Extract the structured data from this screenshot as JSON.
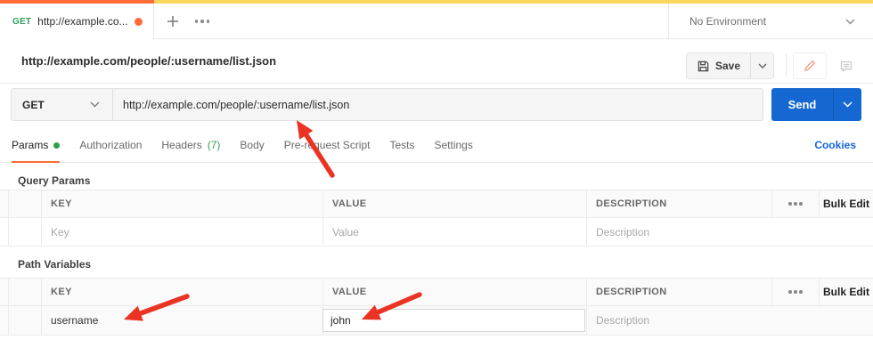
{
  "colors": {
    "accent_orange": "#ff6c37",
    "banner_yellow": "#fbd65f",
    "method_green": "#2fa05c",
    "dot_green": "#2da04b",
    "send_blue": "#1567d2",
    "link_blue": "#1765d8",
    "arrow_red": "#eb3323",
    "pencil_salmon": "#ee9f88"
  },
  "tab_bar": {
    "active_tab": {
      "method": "GET",
      "title": "http://example.co...",
      "modified": true
    },
    "environment_selector": {
      "value": "No Environment"
    }
  },
  "request_header": {
    "title": "http://example.com/people/:username/list.json",
    "save_button": "Save"
  },
  "url_bar": {
    "method": "GET",
    "url": "http://example.com/people/:username/list.json",
    "send_button": "Send"
  },
  "request_tabs": {
    "items": [
      {
        "label": "Params",
        "active": true,
        "has_green_dot": true
      },
      {
        "label": "Authorization"
      },
      {
        "label": "Headers",
        "count": "(7)"
      },
      {
        "label": "Body"
      },
      {
        "label": "Pre-request Script"
      },
      {
        "label": "Tests"
      },
      {
        "label": "Settings"
      }
    ],
    "cookies_link": "Cookies"
  },
  "query_params": {
    "section_title": "Query Params",
    "columns": {
      "key": "KEY",
      "value": "VALUE",
      "description": "DESCRIPTION"
    },
    "bulk_edit": "Bulk Edit",
    "row": {
      "key_placeholder": "Key",
      "value_placeholder": "Value",
      "description_placeholder": "Description"
    }
  },
  "path_variables": {
    "section_title": "Path Variables",
    "columns": {
      "key": "KEY",
      "value": "VALUE",
      "description": "DESCRIPTION"
    },
    "bulk_edit": "Bulk Edit",
    "row": {
      "key": "username",
      "value": "john",
      "description_placeholder": "Description"
    }
  }
}
